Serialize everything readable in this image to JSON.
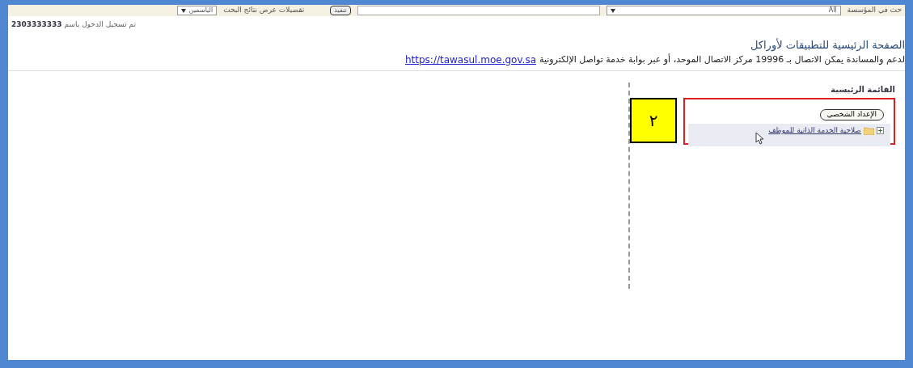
{
  "toolbar": {
    "search_scope_label": "حث في المؤسسة",
    "scope_select": "All",
    "go_button": "تنفيذ",
    "preferences_label": "تفضيلات عرض نتائج البحث",
    "language_select": "الياسمين"
  },
  "login_status": {
    "text": "تم تسجيل الدخول باسم",
    "user": "2303333333"
  },
  "page_title": "الصفحة الرئيسية للتطبيقات لأوراكل",
  "support_line": {
    "text": "لدعم والمساندة يمكن الاتصال بـ 19996 مركز الاتصال الموحد، أو عبر بوابة خدمة تواصل الإلكترونية",
    "link": "https://tawasul.moe.gov.sa"
  },
  "main_menu": {
    "title": "القائمة الرئيسية",
    "personalize_button": "الإعداد الشخصي",
    "items": [
      {
        "label": "صلاحية الخدمة الذاتية للموظف",
        "expanded": false
      }
    ]
  },
  "annotation": {
    "number": "٢"
  }
}
